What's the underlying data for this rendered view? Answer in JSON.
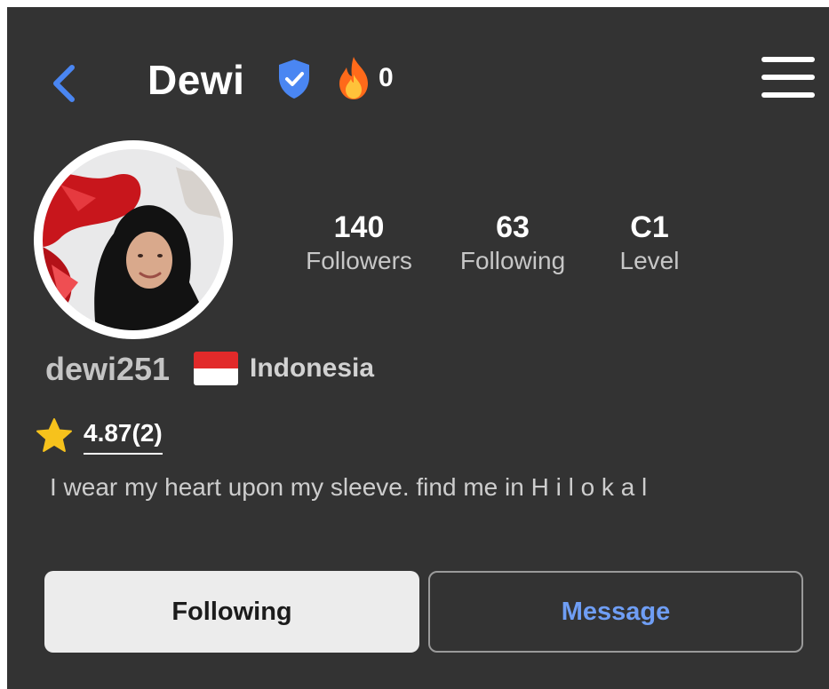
{
  "header": {
    "back_icon": "chevron-left-icon",
    "title": "Dewi",
    "verified_icon": "verified-shield-icon",
    "fire_icon": "fire-icon",
    "fire_count": "0",
    "menu_icon": "hamburger-menu-icon"
  },
  "profile": {
    "avatar": "profile-photo",
    "stats": [
      {
        "value": "140",
        "label": "Followers"
      },
      {
        "value": "63",
        "label": "Following"
      },
      {
        "value": "C1",
        "label": "Level"
      }
    ],
    "username": "dewi251",
    "flag_icon": "indonesia-flag-icon",
    "country": "Indonesia",
    "rating_icon": "star-icon",
    "rating": "4.87(2)",
    "bio": "I wear my heart upon my sleeve.  find me in H i l o k a l"
  },
  "actions": {
    "following_label": "Following",
    "message_label": "Message"
  },
  "colors": {
    "background": "#333333",
    "accent_blue": "#4a86f2",
    "message_text": "#6f9ef5",
    "star": "#f6c21c",
    "fire": "#ff6a1a"
  }
}
